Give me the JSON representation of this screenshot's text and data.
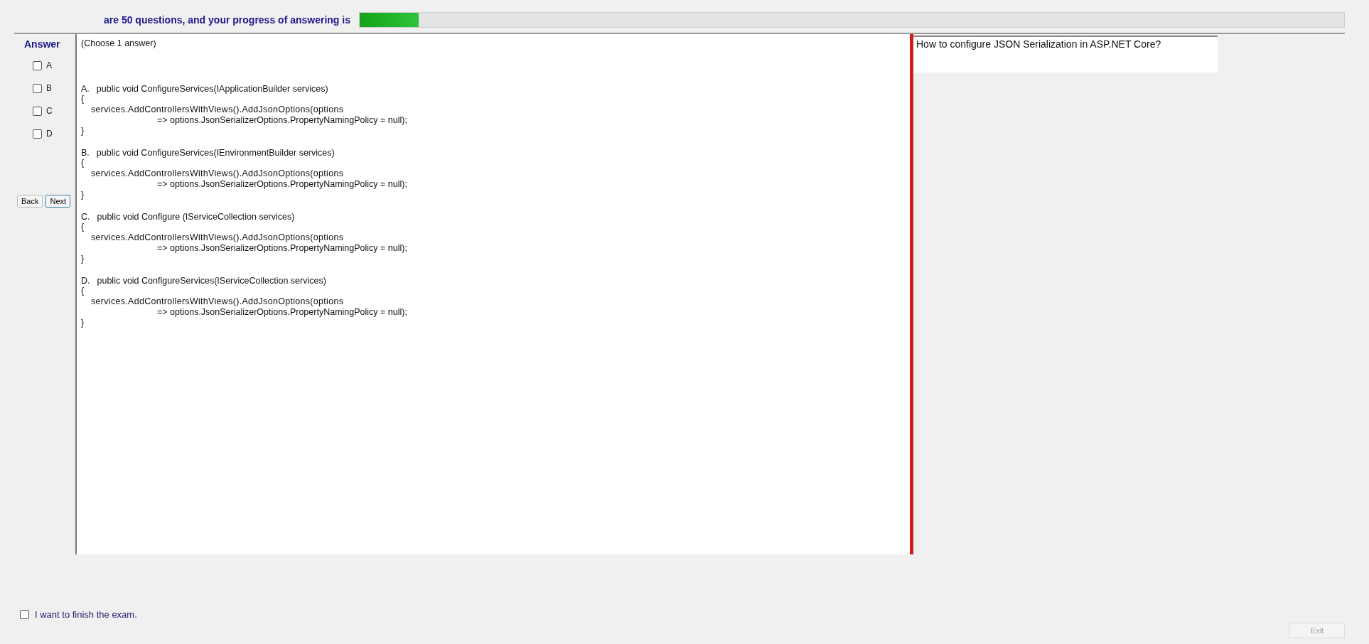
{
  "header": {
    "text": "are 50 questions, and your progress of answering is",
    "progress": {
      "level": 0.06
    }
  },
  "answer_panel": {
    "title": "Answer",
    "choices": [
      {
        "label": "A",
        "checked": false
      },
      {
        "label": "B",
        "checked": false
      },
      {
        "label": "C",
        "checked": false
      },
      {
        "label": "D",
        "checked": false
      }
    ],
    "buttons": [
      {
        "label": "Back",
        "selected": false
      },
      {
        "label": "Next",
        "selected": true
      }
    ]
  },
  "content": {
    "instruction": "(Choose 1 answer)",
    "options": [
      {
        "letter": "A.",
        "signature": "public void ConfigureServices(IApplicationBuilder services)",
        "lines": [
          {
            "kind": "brace",
            "text": "{"
          },
          {
            "kind": "call",
            "text": "services.AddControllersWithViews().AddJsonOptions(options"
          },
          {
            "kind": "continuation",
            "text": "=> options.JsonSerializerOptions.PropertyNamingPolicy = null);"
          },
          {
            "kind": "brace",
            "text": "}"
          }
        ]
      },
      {
        "letter": "B.",
        "signature": "public void ConfigureServices(IEnvironmentBuilder services)",
        "lines": [
          {
            "kind": "brace",
            "text": "{"
          },
          {
            "kind": "call",
            "text": "services.AddControllersWithViews().AddJsonOptions(options"
          },
          {
            "kind": "continuation",
            "text": "=> options.JsonSerializerOptions.PropertyNamingPolicy = null);"
          },
          {
            "kind": "brace",
            "text": "}"
          }
        ]
      },
      {
        "letter": "C.",
        "signature": "public void Configure (IServiceCollection services)",
        "lines": [
          {
            "kind": "brace",
            "text": "{"
          },
          {
            "kind": "call",
            "text": "services.AddControllersWithViews().AddJsonOptions(options"
          },
          {
            "kind": "continuation",
            "text": "=> options.JsonSerializerOptions.PropertyNamingPolicy = null);"
          },
          {
            "kind": "brace",
            "text": "}"
          }
        ]
      },
      {
        "letter": "D.",
        "signature": "public void ConfigureServices(IServiceCollection services)",
        "lines": [
          {
            "kind": "brace",
            "text": "{"
          },
          {
            "kind": "call",
            "text": "services.AddControllersWithViews().AddJsonOptions(options"
          },
          {
            "kind": "continuation",
            "text": "=> options.JsonSerializerOptions.PropertyNamingPolicy = null);"
          },
          {
            "kind": "brace",
            "text": "}"
          }
        ]
      }
    ]
  },
  "question": {
    "text": "How to configure JSON Serialization in ASP.NET Core?"
  },
  "footer": {
    "finish": {
      "label": "I want to finish the exam.",
      "checked": false
    },
    "exit": {
      "label": "Exit",
      "disabled": true
    }
  }
}
